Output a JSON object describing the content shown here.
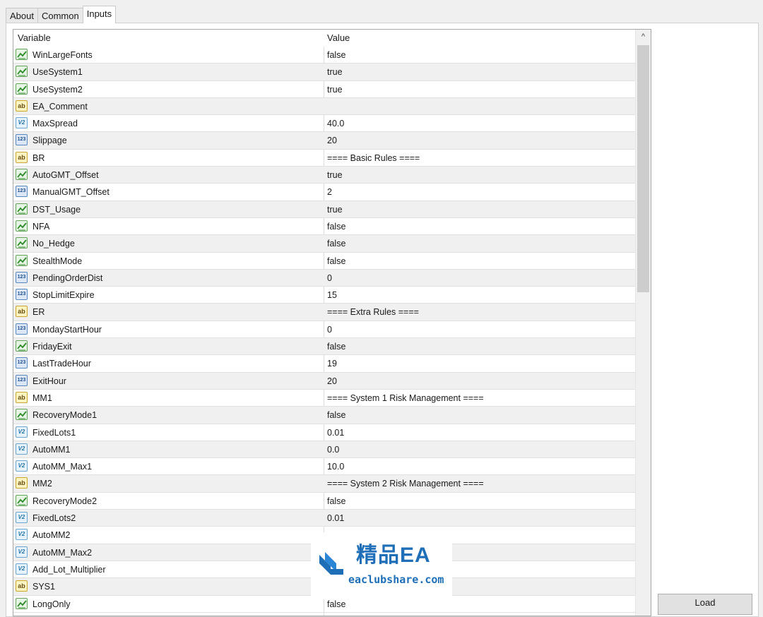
{
  "tabs": [
    {
      "label": "About",
      "active": false
    },
    {
      "label": "Common",
      "active": false
    },
    {
      "label": "Inputs",
      "active": true
    }
  ],
  "grid": {
    "header": {
      "variable": "Variable",
      "value": "Value"
    },
    "rows": [
      {
        "type": "bool",
        "name": "WinLargeFonts",
        "value": "false"
      },
      {
        "type": "bool",
        "name": "UseSystem1",
        "value": "true"
      },
      {
        "type": "bool",
        "name": "UseSystem2",
        "value": "true"
      },
      {
        "type": "string",
        "name": "EA_Comment",
        "value": ""
      },
      {
        "type": "double",
        "name": "MaxSpread",
        "value": "40.0"
      },
      {
        "type": "int",
        "name": "Slippage",
        "value": "20"
      },
      {
        "type": "string",
        "name": "BR",
        "value": "==== Basic Rules ===="
      },
      {
        "type": "bool",
        "name": "AutoGMT_Offset",
        "value": "true"
      },
      {
        "type": "int",
        "name": "ManualGMT_Offset",
        "value": "2"
      },
      {
        "type": "bool",
        "name": "DST_Usage",
        "value": "true"
      },
      {
        "type": "bool",
        "name": "NFA",
        "value": "false"
      },
      {
        "type": "bool",
        "name": "No_Hedge",
        "value": "false"
      },
      {
        "type": "bool",
        "name": "StealthMode",
        "value": "false"
      },
      {
        "type": "int",
        "name": "PendingOrderDist",
        "value": "0"
      },
      {
        "type": "int",
        "name": "StopLimitExpire",
        "value": "15"
      },
      {
        "type": "string",
        "name": "ER",
        "value": "==== Extra Rules ===="
      },
      {
        "type": "int",
        "name": "MondayStartHour",
        "value": "0"
      },
      {
        "type": "bool",
        "name": "FridayExit",
        "value": "false"
      },
      {
        "type": "int",
        "name": "LastTradeHour",
        "value": "19"
      },
      {
        "type": "int",
        "name": "ExitHour",
        "value": "20"
      },
      {
        "type": "string",
        "name": "MM1",
        "value": "==== System 1 Risk Management ===="
      },
      {
        "type": "bool",
        "name": "RecoveryMode1",
        "value": "false"
      },
      {
        "type": "double",
        "name": "FixedLots1",
        "value": "0.01"
      },
      {
        "type": "double",
        "name": "AutoMM1",
        "value": "0.0"
      },
      {
        "type": "double",
        "name": "AutoMM_Max1",
        "value": "10.0"
      },
      {
        "type": "string",
        "name": "MM2",
        "value": "==== System 2 Risk Management ===="
      },
      {
        "type": "bool",
        "name": "RecoveryMode2",
        "value": "false"
      },
      {
        "type": "double",
        "name": "FixedLots2",
        "value": "0.01"
      },
      {
        "type": "double",
        "name": "AutoMM2",
        "value": ""
      },
      {
        "type": "double",
        "name": "AutoMM_Max2",
        "value": ""
      },
      {
        "type": "double",
        "name": "Add_Lot_Multiplier",
        "value": ""
      },
      {
        "type": "string",
        "name": "SYS1",
        "value": ""
      },
      {
        "type": "bool",
        "name": "LongOnly",
        "value": "false"
      }
    ]
  },
  "scrollbar": {
    "up_glyph": "^"
  },
  "buttons": {
    "load": "Load"
  },
  "watermark": {
    "title": "精品EA",
    "url": "eaclubshare.com"
  },
  "icon_labels": {
    "string": "ab",
    "int": "123",
    "double": "V2"
  }
}
